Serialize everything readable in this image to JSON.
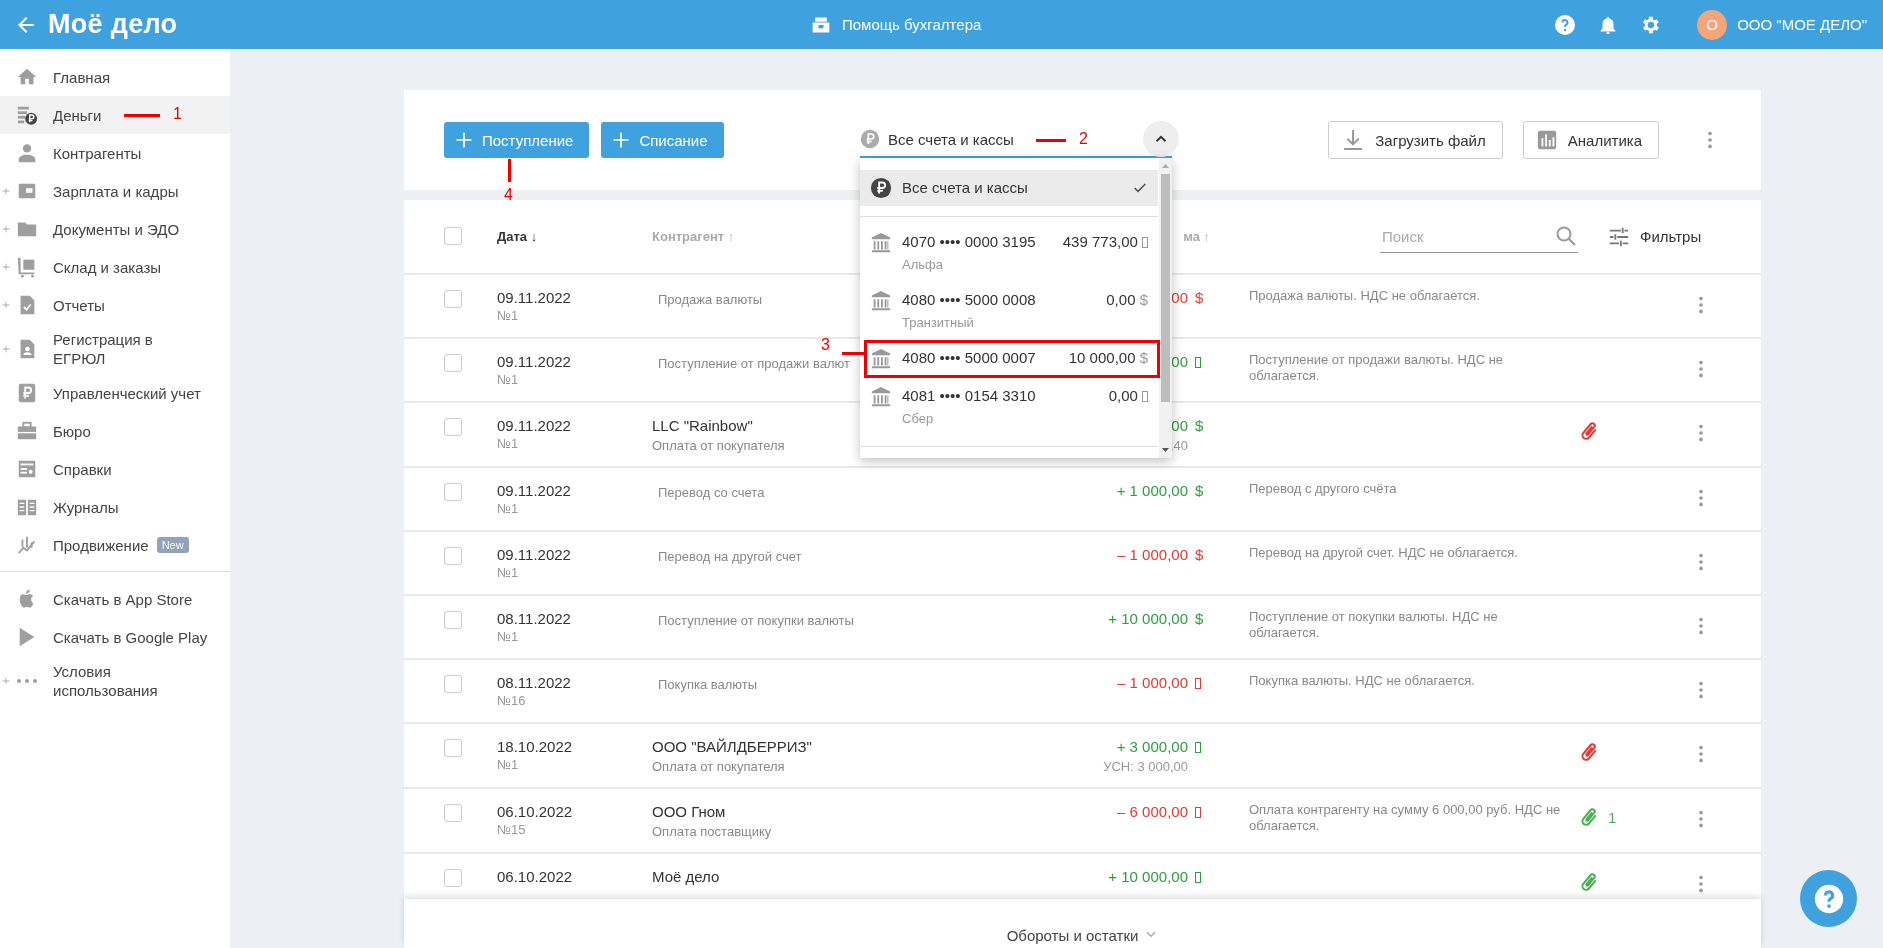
{
  "header": {
    "logo": "Моё дело",
    "assistant": "Помощь бухгалтера",
    "avatar_letter": "О",
    "company": "ООО \"МОЕ ДЕЛО\""
  },
  "sidebar": {
    "items": [
      {
        "label": "Главная",
        "selected": false,
        "expandable": false
      },
      {
        "label": "Деньги",
        "selected": true,
        "expandable": false,
        "annotation": "1"
      },
      {
        "label": "Контрагенты",
        "selected": false,
        "expandable": false
      },
      {
        "label": "Зарплата и кадры",
        "selected": false,
        "expandable": true
      },
      {
        "label": "Документы и ЭДО",
        "selected": false,
        "expandable": true
      },
      {
        "label": "Склад и заказы",
        "selected": false,
        "expandable": true
      },
      {
        "label": "Отчеты",
        "selected": false,
        "expandable": true
      },
      {
        "label": "Регистрация в ЕГРЮЛ",
        "selected": false,
        "expandable": true
      },
      {
        "label": "Управленческий учет",
        "selected": false,
        "expandable": false
      },
      {
        "label": "Бюро",
        "selected": false,
        "expandable": false
      },
      {
        "label": "Справки",
        "selected": false,
        "expandable": false
      },
      {
        "label": "Журналы",
        "selected": false,
        "expandable": false
      },
      {
        "label": "Продвижение",
        "selected": false,
        "expandable": false,
        "badge": "New"
      }
    ],
    "links": [
      {
        "label": "Скачать в App Store",
        "expandable": false
      },
      {
        "label": "Скачать в Google Play",
        "expandable": false
      },
      {
        "label": "Условия использования",
        "expandable": true
      }
    ]
  },
  "toolbar": {
    "buttons": [
      {
        "label": "Поступление",
        "annotation": "4"
      },
      {
        "label": "Списание"
      }
    ],
    "account_select": {
      "value": "Все счета и кассы",
      "expanded": true,
      "annotation": "2",
      "options": [
        {
          "kind": "all",
          "label": "Все счета и кассы",
          "selected": true
        },
        {
          "kind": "account",
          "number": "4070 •••• 0000 3195",
          "balance": "439 773,00",
          "currency": {
            "kind": "box"
          },
          "bank": "Альфа",
          "selected": false
        },
        {
          "kind": "account",
          "number": "4080 •••• 5000 0008",
          "balance": "0,00",
          "currency": {
            "kind": "symbol",
            "text": "$"
          },
          "bank": "Транзитный",
          "selected": false
        },
        {
          "kind": "account",
          "number": "4080 •••• 5000 0007",
          "balance": "10 000,00",
          "currency": {
            "kind": "symbol",
            "text": "$"
          },
          "selected": false,
          "annotation": "3"
        },
        {
          "kind": "account",
          "number": "4081 •••• 0154 3310",
          "balance": "0,00",
          "currency": {
            "kind": "box"
          },
          "bank": "Сбер",
          "selected": false
        }
      ]
    },
    "actions": [
      {
        "label": "Загрузить файл"
      },
      {
        "label": "Аналитика"
      }
    ]
  },
  "table": {
    "all_checked": false,
    "columns": [
      {
        "label": "Дата ↓",
        "sorted": true
      },
      {
        "label": "Контрагент ↑",
        "sorted": false
      },
      {
        "label": "ма ↑",
        "sorted": false
      }
    ],
    "search": {
      "placeholder": "Поиск"
    },
    "filters": "Фильтры",
    "rows": [
      {
        "checked": false,
        "date": "09.11.2022",
        "number": "№1",
        "description": "Продажа валюты",
        "amount": "00",
        "kind": "expense",
        "currency": {
          "kind": "symbol",
          "text": "$"
        },
        "comment": "Продажа валюты. НДС не облагается."
      },
      {
        "checked": false,
        "date": "09.11.2022",
        "number": "№1",
        "description": "Поступление от продажи валют",
        "amount": "00",
        "kind": "income",
        "currency": {
          "kind": "box"
        },
        "comment": "Поступление от продажи валюты. НДС не облагается."
      },
      {
        "checked": false,
        "date": "09.11.2022",
        "number": "№1",
        "counterparty": "LLC \"Rainbow\"",
        "description": "Оплата от покупателя",
        "amount": "00",
        "kind": "income",
        "currency": {
          "kind": "symbol",
          "text": "$"
        },
        "tax": ",40",
        "attachment": {
          "color": "#e53935"
        }
      },
      {
        "checked": false,
        "date": "09.11.2022",
        "number": "№1",
        "description": "Перевод со счета",
        "amount": "+ 1 000,00",
        "kind": "income",
        "currency": {
          "kind": "symbol",
          "text": "$"
        },
        "comment": "Перевод с другого счёта"
      },
      {
        "checked": false,
        "date": "09.11.2022",
        "number": "№1",
        "description": "Перевод на другой счет",
        "amount": "– 1 000,00",
        "kind": "expense",
        "currency": {
          "kind": "symbol",
          "text": "$"
        },
        "comment": "Перевод на другой счет. НДС не облагается."
      },
      {
        "checked": false,
        "date": "08.11.2022",
        "number": "№1",
        "description": "Поступление от покупки валюты",
        "amount": "+ 10 000,00",
        "kind": "income",
        "currency": {
          "kind": "symbol",
          "text": "$"
        },
        "comment": "Поступление от покупки валюты. НДС не облагается."
      },
      {
        "checked": false,
        "date": "08.11.2022",
        "number": "№16",
        "description": "Покупка валюты",
        "amount": "– 1 000,00",
        "kind": "expense",
        "currency": {
          "kind": "box"
        },
        "comment": "Покупка валюты. НДС не облагается."
      },
      {
        "checked": false,
        "date": "18.10.2022",
        "number": "№1",
        "counterparty": "ООО \"ВАЙЛДБЕРРИЗ\"",
        "description": "Оплата от покупателя",
        "amount": "+ 3 000,00",
        "kind": "income",
        "currency": {
          "kind": "box"
        },
        "tax": "УСН: 3 000,00",
        "attachment": {
          "color": "#e53935"
        }
      },
      {
        "checked": false,
        "date": "06.10.2022",
        "number": "№15",
        "counterparty": "ООО Гном",
        "description": "Оплата поставщику",
        "amount": "– 6 000,00",
        "kind": "expense",
        "currency": {
          "kind": "box"
        },
        "comment": "Оплата контрагенту на сумму 6 000,00 руб. НДС не облагается.",
        "attachment": {
          "color": "#4caf50",
          "count": "1"
        }
      },
      {
        "checked": false,
        "date": "06.10.2022",
        "counterparty": "Моё дело",
        "amount": "+ 10 000,00",
        "kind": "income",
        "currency": {
          "kind": "box"
        },
        "attachment": {
          "color": "#4caf50"
        }
      }
    ]
  },
  "footer": {
    "label": "Обороты и остатки"
  }
}
